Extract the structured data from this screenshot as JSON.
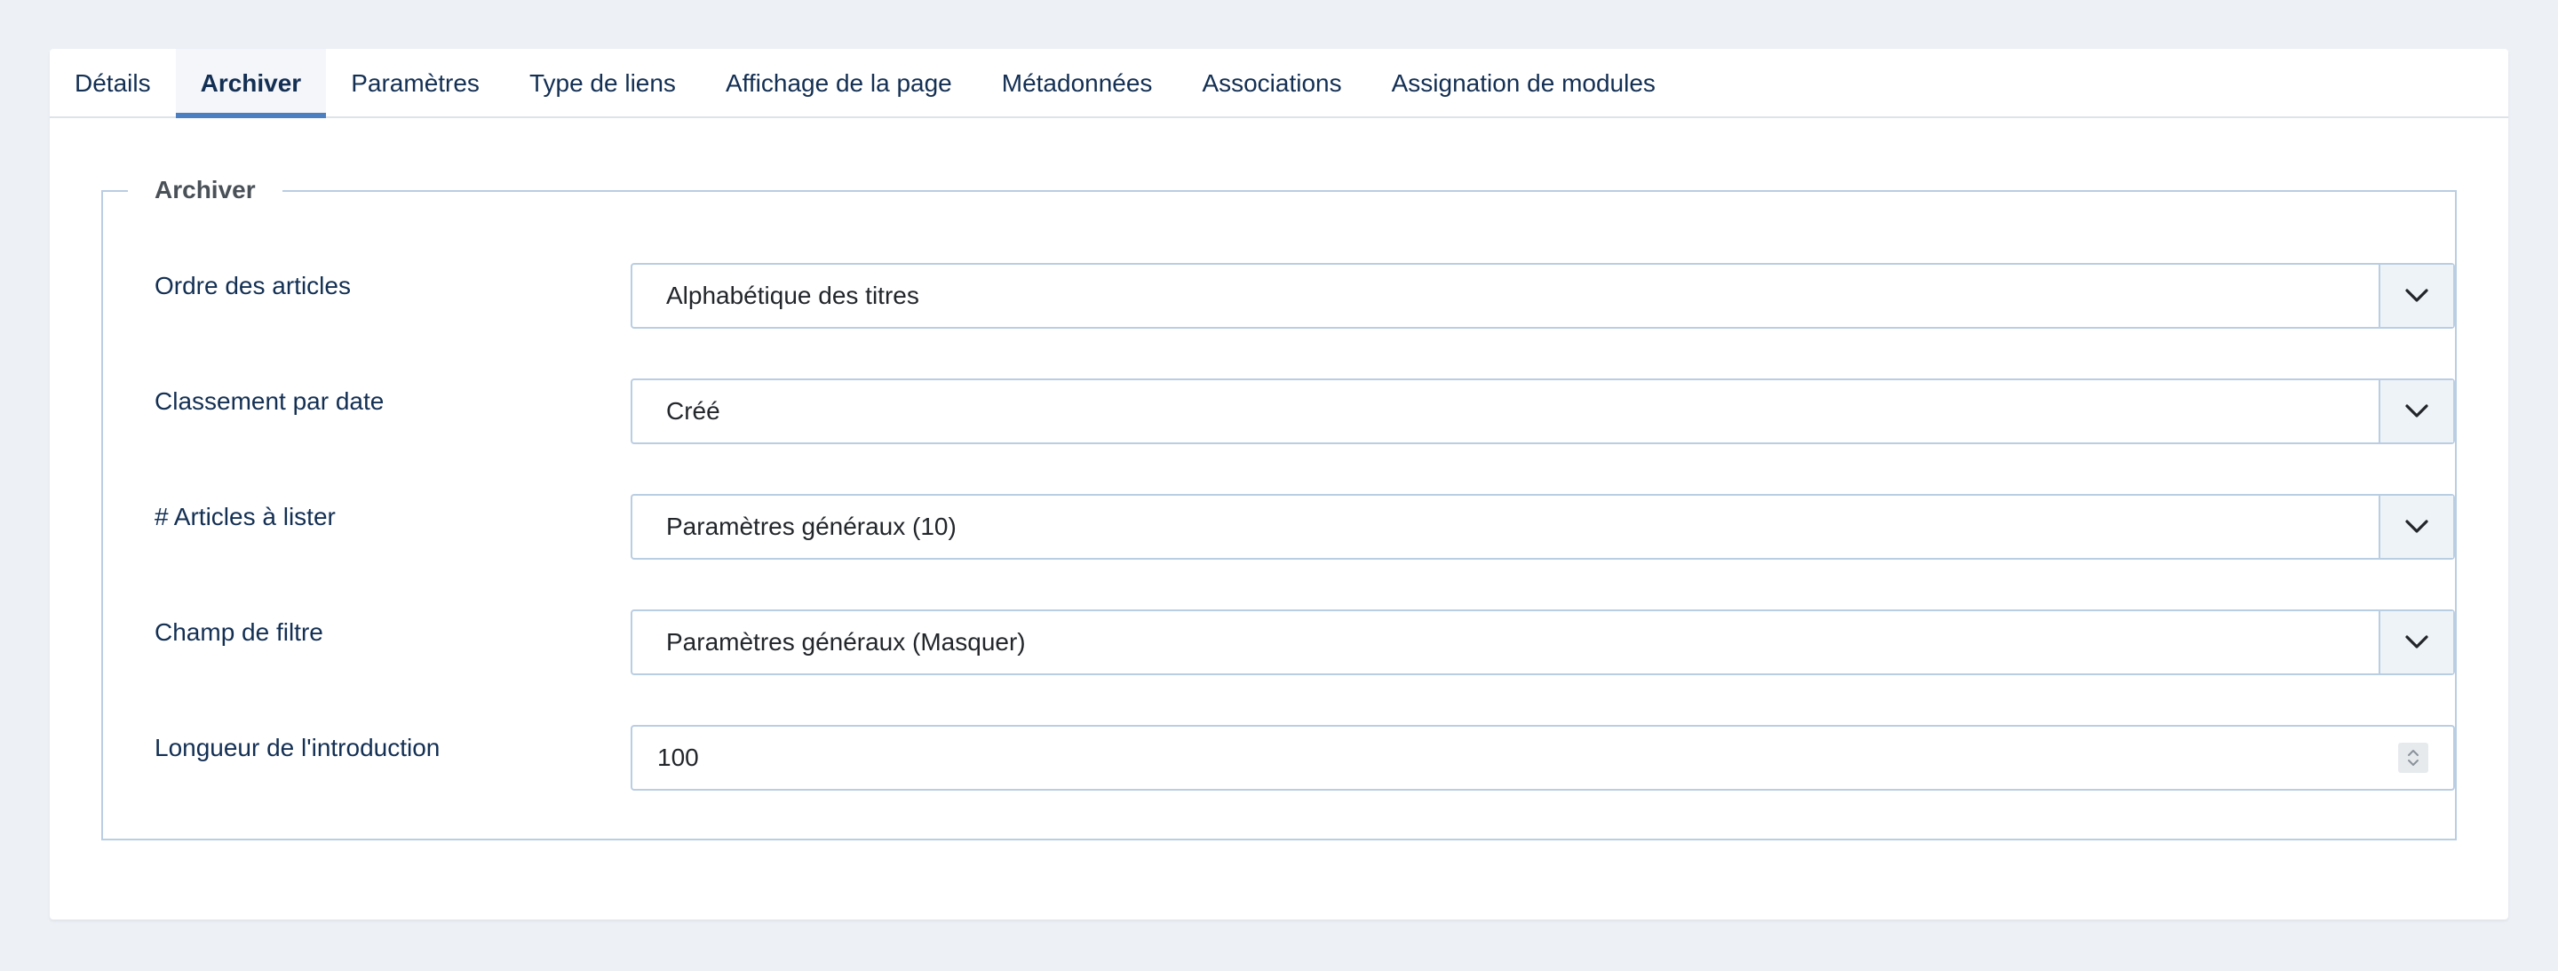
{
  "tabs": [
    {
      "label": "Détails"
    },
    {
      "label": "Archiver"
    },
    {
      "label": "Paramètres"
    },
    {
      "label": "Type de liens"
    },
    {
      "label": "Affichage de la page"
    },
    {
      "label": "Métadonnées"
    },
    {
      "label": "Associations"
    },
    {
      "label": "Assignation de modules"
    }
  ],
  "active_tab": "Archiver",
  "fieldset": {
    "legend": "Archiver",
    "fields": [
      {
        "label": "Ordre des articles",
        "value": "Alphabétique des titres",
        "type": "select",
        "icon": "chevron-down-icon"
      },
      {
        "label": "Classement par date",
        "value": "Créé",
        "type": "select",
        "icon": "chevron-down-icon"
      },
      {
        "label": "# Articles à lister",
        "value": "Paramètres généraux (10)",
        "type": "select",
        "icon": "chevron-down-icon"
      },
      {
        "label": "Champ de filtre",
        "value": "Paramètres généraux (Masquer)",
        "type": "select",
        "icon": "chevron-down-icon"
      },
      {
        "label": "Longueur de l'introduction",
        "value": "100",
        "type": "number",
        "icon": "spinner-icon"
      }
    ]
  },
  "colors": {
    "page_background": "#edf1f6",
    "accent": "#4b7fc1",
    "border": "#b9cde3",
    "text_dark": "#132f53"
  }
}
